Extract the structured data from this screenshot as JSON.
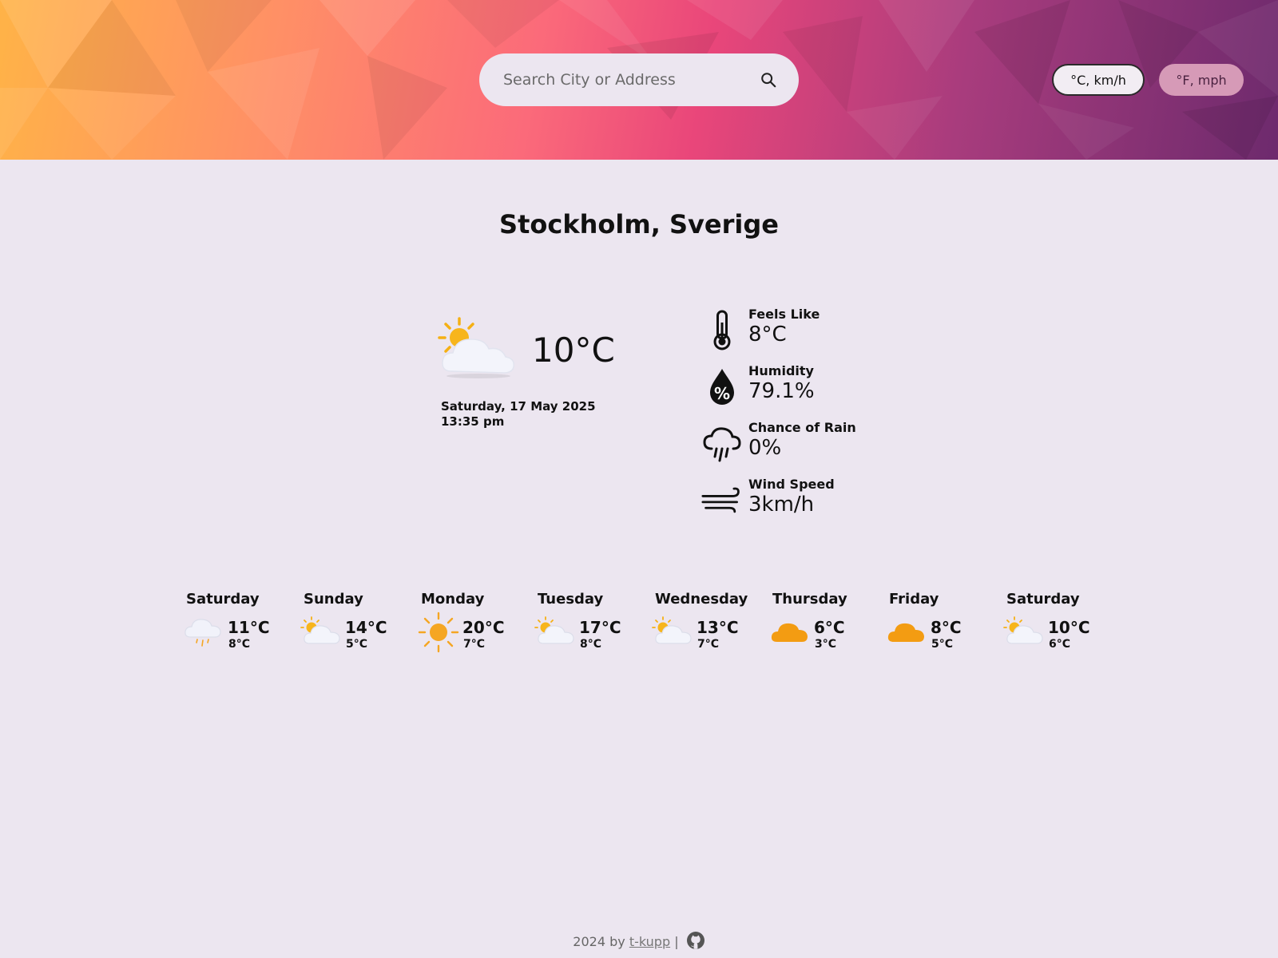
{
  "search": {
    "placeholder": "Search City or Address",
    "icon": "search-icon"
  },
  "units": {
    "metric_label": "°C, km/h",
    "imperial_label": "°F, mph",
    "selected": "metric"
  },
  "location": {
    "name": "Stockholm, Sverige"
  },
  "current": {
    "icon": "partly-cloudy-day-icon",
    "temperature": "10°C",
    "date": "Saturday, 17 May 2025",
    "time": "13:35 pm"
  },
  "details": [
    {
      "icon": "thermometer-icon",
      "label": "Feels Like",
      "value": "8°C"
    },
    {
      "icon": "humidity-drop-icon",
      "label": "Humidity",
      "value": "79.1%"
    },
    {
      "icon": "rain-cloud-icon",
      "label": "Chance of Rain",
      "value": "0%"
    },
    {
      "icon": "wind-icon",
      "label": "Wind Speed",
      "value": "3km/h"
    }
  ],
  "forecast": [
    {
      "day": "Saturday",
      "icon": "showers-icon",
      "max": "11°C",
      "min": "8°C"
    },
    {
      "day": "Sunday",
      "icon": "partly-cloudy-day-icon",
      "max": "14°C",
      "min": "5°C"
    },
    {
      "day": "Monday",
      "icon": "clear-day-icon",
      "max": "20°C",
      "min": "7°C"
    },
    {
      "day": "Tuesday",
      "icon": "partly-cloudy-day-icon",
      "max": "17°C",
      "min": "8°C"
    },
    {
      "day": "Wednesday",
      "icon": "partly-cloudy-day-icon",
      "max": "13°C",
      "min": "7°C"
    },
    {
      "day": "Thursday",
      "icon": "cloudy-icon",
      "max": "6°C",
      "min": "3°C"
    },
    {
      "day": "Friday",
      "icon": "cloudy-icon",
      "max": "8°C",
      "min": "5°C"
    },
    {
      "day": "Saturday",
      "icon": "partly-cloudy-day-icon",
      "max": "10°C",
      "min": "6°C"
    }
  ],
  "footer": {
    "prefix": "2024 by",
    "author": "t-kupp",
    "separator": "|",
    "icon": "github-icon"
  },
  "colors": {
    "background": "#ece6f0",
    "accent_sun": "#f5a623",
    "cloud_orange": "#f39c12",
    "imperial_button": "#d69ab7"
  }
}
